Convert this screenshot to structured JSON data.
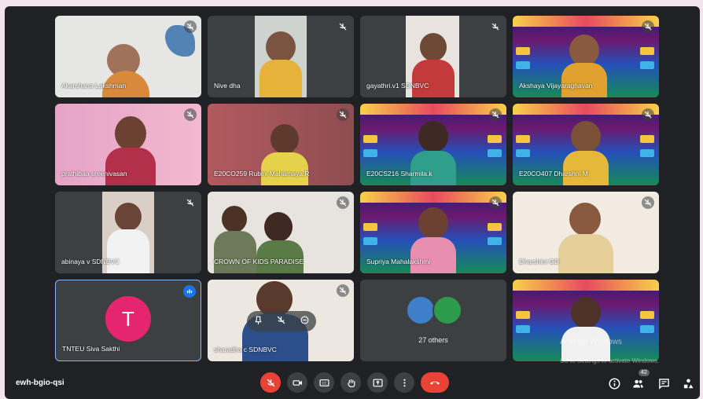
{
  "meeting": {
    "code": "ewh-bgio-qsi",
    "participant_count": "42"
  },
  "participants": [
    {
      "name": "Akarshana Lakshman"
    },
    {
      "name": "Nive dha"
    },
    {
      "name": "gayathri.v1 SDNBVC"
    },
    {
      "name": "Akshaya Vijayaraghavan"
    },
    {
      "name": "prathibaa sreenivasan"
    },
    {
      "name": "E20CO259 Rubini Mahamaya.R"
    },
    {
      "name": "E20CS216 Sharmila.k"
    },
    {
      "name": "E20CO407 Dharshni M"
    },
    {
      "name": "abinaya v SDNBVC"
    },
    {
      "name": "CROWN OF KIDS PARADISE"
    },
    {
      "name": "Supriya Mahalakshmi"
    },
    {
      "name": "Dharshini GD"
    },
    {
      "name": "TNTEU Siva Sakthi",
      "initial": "T"
    },
    {
      "name": "sharadha c SDNBVC"
    }
  ],
  "others": {
    "label": "27 others"
  },
  "watermark": {
    "line1": "Activate Windows",
    "line2": "Go to Settings to activate Windows."
  },
  "colors": {
    "background": "#202124",
    "end_call": "#ea4335",
    "avatar": "#e5266f",
    "active_border": "#8ab4f8"
  },
  "icons": [
    "mic-off-icon",
    "camera-icon",
    "captions-icon",
    "raise-hand-icon",
    "present-icon",
    "more-icon",
    "end-call-icon",
    "info-icon",
    "people-icon",
    "chat-icon",
    "activities-icon",
    "speaking-icon",
    "pin-icon",
    "minus-circle-icon"
  ]
}
